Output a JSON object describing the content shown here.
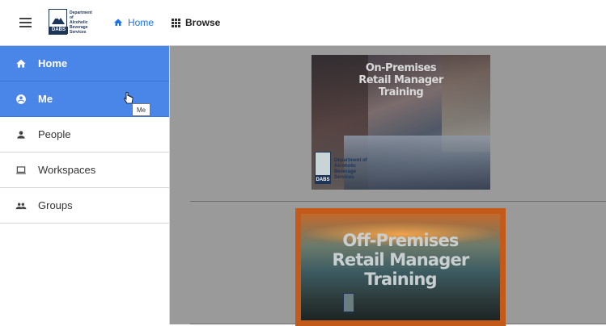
{
  "header": {
    "logo": {
      "text_lines": [
        "Department of",
        "Alcoholic",
        "Beverage",
        "Services"
      ],
      "badge": "DABS"
    },
    "nav": {
      "home_label": "Home",
      "browse_label": "Browse"
    }
  },
  "sidebar": {
    "items": [
      {
        "label": "Home",
        "icon": "home-icon",
        "active": true
      },
      {
        "label": "Me",
        "icon": "account-circle-icon",
        "active": true
      },
      {
        "label": "People",
        "icon": "person-icon",
        "active": false
      },
      {
        "label": "Workspaces",
        "icon": "laptop-icon",
        "active": false
      },
      {
        "label": "Groups",
        "icon": "group-icon",
        "active": false
      }
    ],
    "tooltip": "Me"
  },
  "main": {
    "tiles": [
      {
        "title_lines": [
          "On-Premises",
          "Retail Manager",
          "Training"
        ],
        "logo_badge": "DABS",
        "logo_text_lines": [
          "Department of",
          "Alcoholic",
          "Beverage",
          "Services"
        ]
      },
      {
        "title_lines": [
          "Off-Premises",
          "Retail Manager",
          "Training"
        ]
      }
    ]
  },
  "colors": {
    "accent": "#4a86e8",
    "link": "#1a73e8",
    "tile_bg": "#9a9a9a",
    "brand_navy": "#1d3557"
  }
}
